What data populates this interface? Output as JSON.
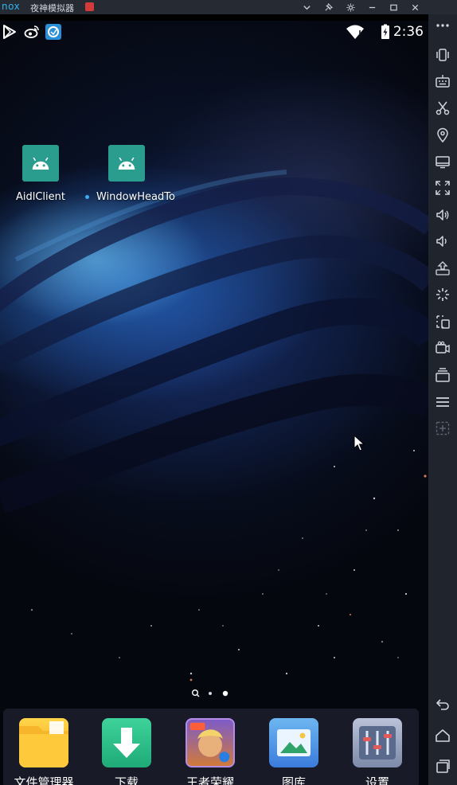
{
  "window": {
    "logo_text": "nox",
    "title": "夜神模拟器"
  },
  "status_bar": {
    "time": "2:36",
    "left_icons": [
      "play-store-icon",
      "weibo-icon",
      "app-store-icon"
    ],
    "right_icons": [
      "wifi-icon",
      "battery-charging-icon"
    ]
  },
  "desktop": {
    "apps": [
      {
        "label": "AidlClient",
        "icon": "android-icon"
      },
      {
        "label": "WindowHeadTo",
        "icon": "android-icon",
        "new_indicator": true
      }
    ],
    "page_indicator": {
      "search_page": true,
      "pages": 2,
      "current": 2
    }
  },
  "dock": {
    "apps": [
      {
        "label": "文件管理器",
        "icon": "folder-icon"
      },
      {
        "label": "下载",
        "icon": "download-icon"
      },
      {
        "label": "王者荣耀",
        "icon": "game-icon"
      },
      {
        "label": "图库",
        "icon": "gallery-icon"
      },
      {
        "label": "设置",
        "icon": "settings-icon"
      }
    ]
  },
  "emulator_toolbar": {
    "buttons": [
      "more-icon",
      "shake-icon",
      "keyboard-icon",
      "scissors-icon",
      "location-icon",
      "screen-icon",
      "fullscreen-icon",
      "volume-up-icon",
      "volume-down-icon",
      "apk-install-icon",
      "loading-icon",
      "screenshot-icon",
      "video-record-icon",
      "multi-instance-icon",
      "menu-icon",
      "add-icon",
      "back-icon",
      "home-icon",
      "recents-icon"
    ]
  },
  "colors": {
    "title_bar": "#262a33",
    "toolbar": "#20242c",
    "accent": "#2fb5ee",
    "app_icon": "#2a9d8f"
  }
}
